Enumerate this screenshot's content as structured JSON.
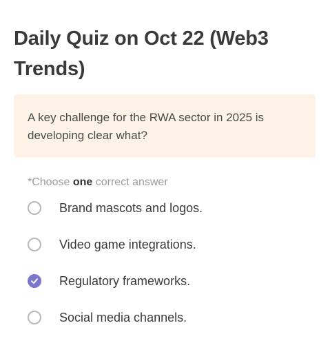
{
  "quiz": {
    "title": "Daily Quiz on Oct 22 (Web3 Trends)",
    "question": "A key challenge for the RWA sector in 2025 is developing clear what?",
    "instruction_prefix": "*Choose ",
    "instruction_emphasis": "one",
    "instruction_suffix": " correct answer",
    "options": [
      {
        "label": "Brand mascots and logos.",
        "selected": false
      },
      {
        "label": "Video game integrations.",
        "selected": false
      },
      {
        "label": "Regulatory frameworks.",
        "selected": true
      },
      {
        "label": "Social media channels.",
        "selected": false
      }
    ],
    "colors": {
      "selected_radio": "#7b78cc",
      "question_background": "#fdf3e6"
    },
    "icons": {
      "selected": "check-icon",
      "unselected": "radio-empty-icon"
    }
  }
}
